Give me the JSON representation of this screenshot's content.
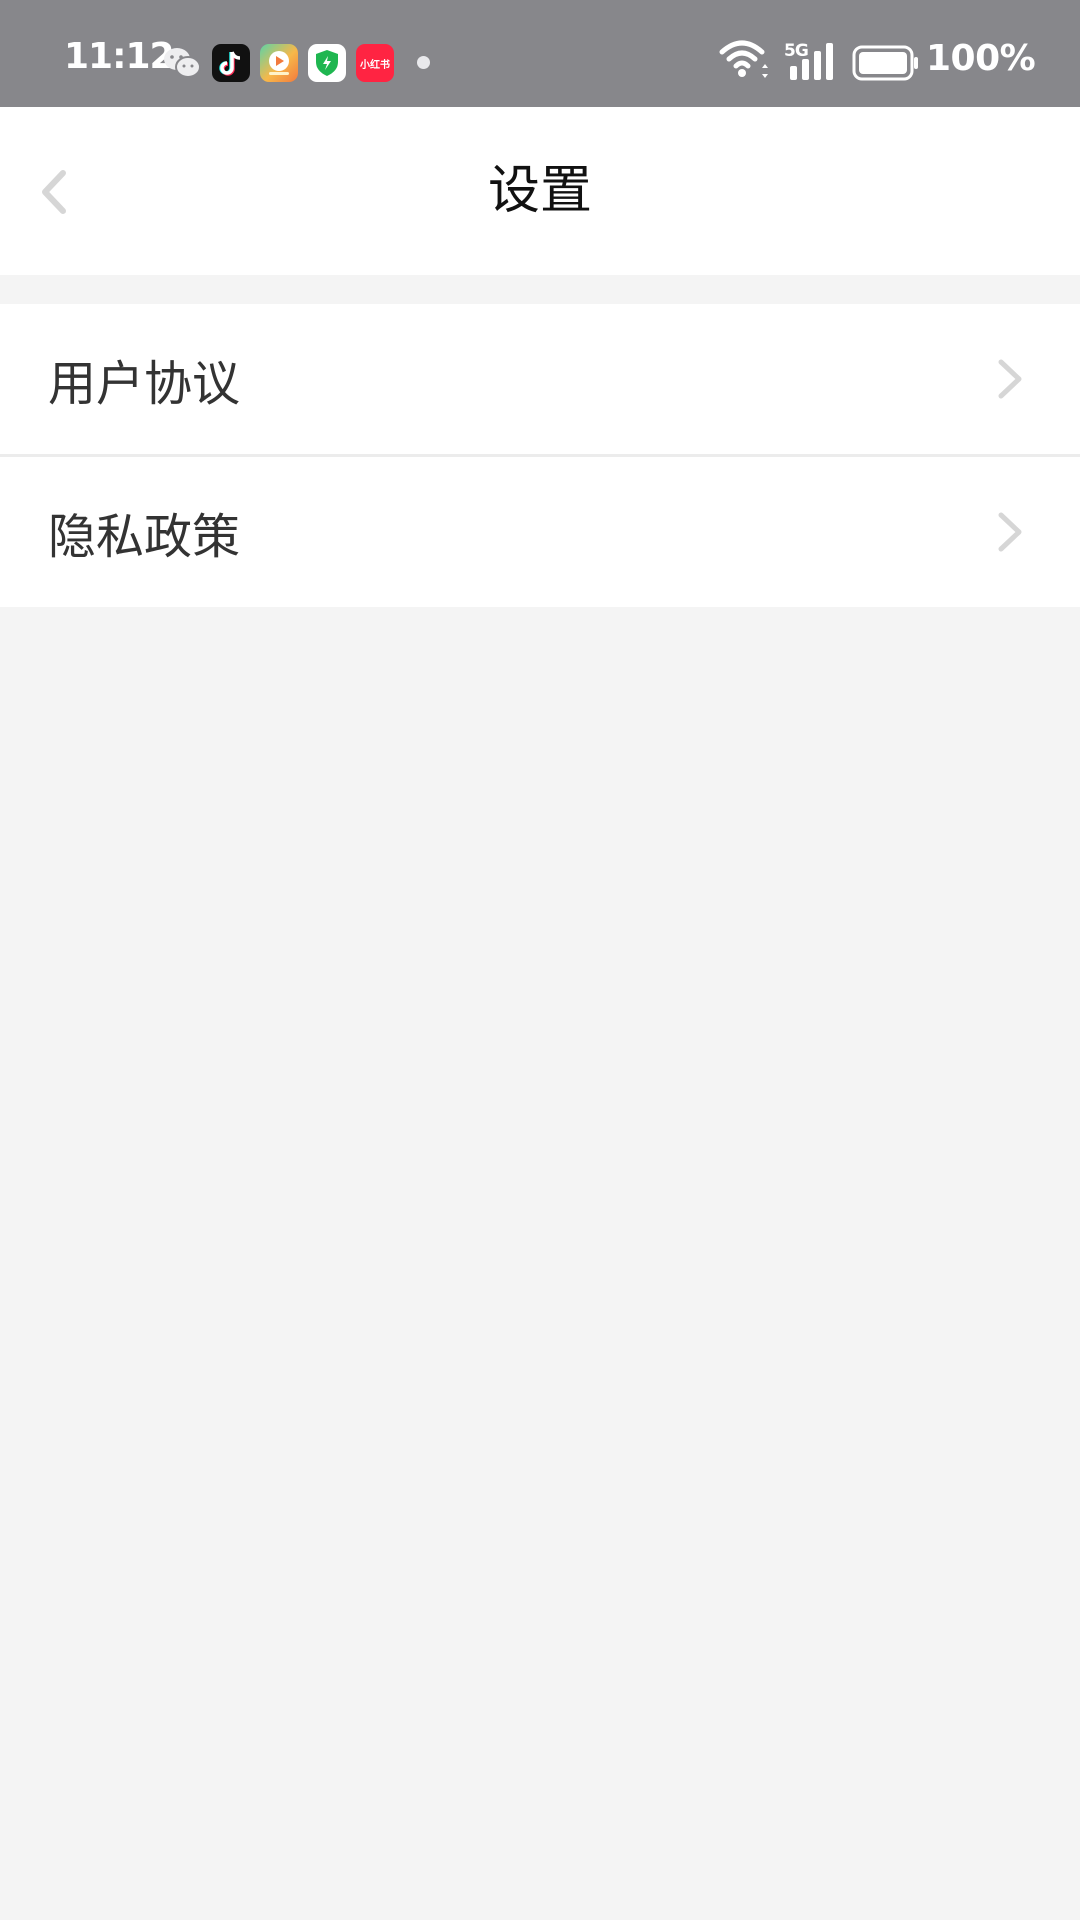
{
  "status_bar": {
    "time": "11:12",
    "network": "5G",
    "battery": "100%",
    "icons": [
      "wechat-icon",
      "tiktok-icon",
      "video-app-icon",
      "security-shield-icon",
      "xiaohongshu-icon"
    ],
    "xiaohongshu_label": "小红书"
  },
  "header": {
    "title": "设置"
  },
  "list": {
    "items": [
      {
        "label": "用户协议"
      },
      {
        "label": "隐私政策"
      }
    ]
  },
  "colors": {
    "status_bar_bg": "#87878b",
    "page_bg": "#f4f4f4",
    "chevron": "#d6d6d6"
  }
}
